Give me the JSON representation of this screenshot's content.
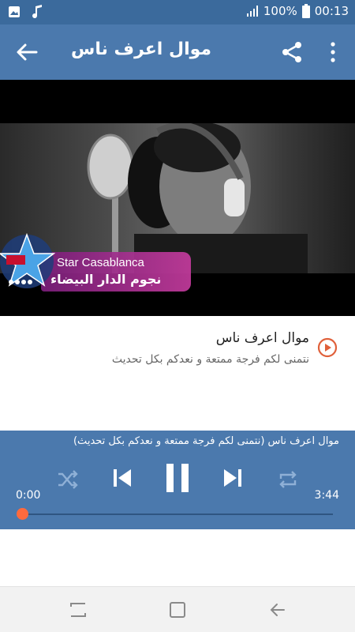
{
  "status_bar": {
    "battery": "100%",
    "time": "00:13",
    "icons": [
      "gallery-icon",
      "music-note-icon",
      "signal-icon",
      "battery-icon"
    ]
  },
  "toolbar": {
    "title": "موال اعرف ناس",
    "icons": [
      "back-arrow-icon",
      "share-icon",
      "more-vert-icon"
    ]
  },
  "video": {
    "watermark_en": "Star Casablanca",
    "watermark_ar": "نجوم الدار البيضاء",
    "watermark_small": "STARS.CASABLANCA"
  },
  "track": {
    "title": "موال اعرف ناس",
    "subtitle": "نتمنى لكم فرجة ممتعة و نعدكم بكل تحديث"
  },
  "player": {
    "now_playing": "موال اعرف ناس (نتمنى لكم فرجة ممتعة و نعدكم بكل تحديث)",
    "current_time": "0:00",
    "total_time": "3:44",
    "progress": 0,
    "icons": [
      "shuffle-icon",
      "skip-previous-icon",
      "pause-icon",
      "skip-next-icon",
      "repeat-icon"
    ]
  },
  "colors": {
    "status_bar": "#3b6a9c",
    "toolbar": "#4b79ad",
    "accent": "#ff6a3d",
    "play_icon": "#e0603a"
  },
  "navbar": {
    "icons": [
      "recent-apps-icon",
      "home-icon",
      "back-icon"
    ]
  }
}
